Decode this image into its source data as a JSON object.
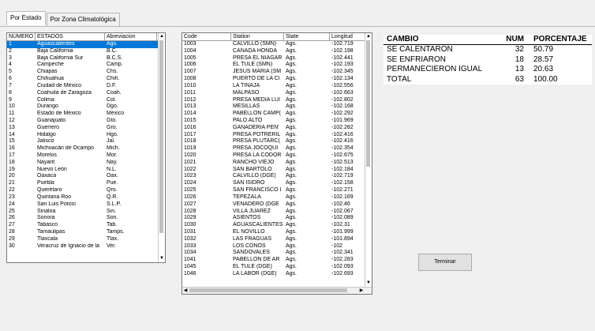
{
  "tabs": [
    {
      "label": "Por Estado",
      "active": true
    },
    {
      "label": "Por Zona Climatológica",
      "active": false
    }
  ],
  "states_table": {
    "headers": [
      "NÚMERO",
      "ESTADOS",
      "Abreviacion"
    ],
    "rows": [
      [
        "1",
        "Aguascalientes",
        "Ags."
      ],
      [
        "2",
        "Baja California",
        "B.C."
      ],
      [
        "3",
        "Baja California Sur",
        "B.C.S."
      ],
      [
        "4",
        "Campeche",
        "Camp."
      ],
      [
        "5",
        "Chiapas",
        "Chs."
      ],
      [
        "6",
        "Chihuahua",
        "Chih."
      ],
      [
        "7",
        "Ciudad de México",
        "D.F."
      ],
      [
        "8",
        "Coahuila de Zaragoza",
        "Coah."
      ],
      [
        "9",
        "Colima",
        "Col."
      ],
      [
        "10",
        "Durango",
        "Dgo."
      ],
      [
        "11",
        "Estado de México",
        "México"
      ],
      [
        "12",
        "Guanajuato",
        "Gto."
      ],
      [
        "13",
        "Guerrero",
        "Gro."
      ],
      [
        "14",
        "Hidalgo",
        "Hgo."
      ],
      [
        "15",
        "Jalisco",
        "Jal."
      ],
      [
        "16",
        "Michoacán de Ocampo",
        "Mich."
      ],
      [
        "17",
        "Morelos",
        "Mor."
      ],
      [
        "18",
        "Nayarit",
        "Nay."
      ],
      [
        "19",
        "Nuevo León",
        "N.L."
      ],
      [
        "20",
        "Oaxaca",
        "Oax."
      ],
      [
        "21",
        "Puebla",
        "Pue."
      ],
      [
        "22",
        "Querétaro",
        "Qro."
      ],
      [
        "23",
        "Quintana Roo",
        "Q.R."
      ],
      [
        "24",
        "San Luis Potosí",
        "S.L.P."
      ],
      [
        "25",
        "Sinaloa",
        "Sin."
      ],
      [
        "26",
        "Sonora",
        "Son."
      ],
      [
        "27",
        "Tabasco",
        "Tab."
      ],
      [
        "28",
        "Tamaulipas",
        "Tamps."
      ],
      [
        "29",
        "Tlaxcala",
        "Tlax."
      ],
      [
        "30",
        "Veracruz de Ignacio de la",
        "Ver."
      ]
    ],
    "selected_index": 0
  },
  "stations_table": {
    "headers": [
      "Code",
      "Station",
      "State",
      "Longitud"
    ],
    "rows": [
      [
        "1003",
        "CALVILLO (SMN)",
        "Ags.",
        "-102.719"
      ],
      [
        "1004",
        "CAÑADA HONDA",
        "Ags.",
        "-102.198"
      ],
      [
        "1005",
        "PRESA EL NIAGAR",
        "Ags.",
        "-102.441"
      ],
      [
        "1006",
        "EL TULE (SMN)",
        "Ags.",
        "-102.193"
      ],
      [
        "1007",
        "JESUS MARIA (SM",
        "Ags.",
        "-102.345"
      ],
      [
        "1008",
        "PUERTO DE LA CI",
        "Ags.",
        "-102.134"
      ],
      [
        "1010",
        "LA TINAJA",
        "Ags.",
        "-102.556"
      ],
      [
        "1011",
        "MALPASO",
        "Ags.",
        "-102.663"
      ],
      [
        "1012",
        "PRESA MEDIA LUI",
        "Ags.",
        "-102.802"
      ],
      [
        "1013",
        "MESILLAS",
        "Ags.",
        "-102.168"
      ],
      [
        "1014",
        "PABELLON CAMP(",
        "Ags.",
        "-102.292"
      ],
      [
        "1015",
        "PALO ALTO",
        "Ags.",
        "-101.969"
      ],
      [
        "1016",
        "GANADERIA PEÑ'",
        "Ags.",
        "-102.282"
      ],
      [
        "1017",
        "PRESA POTRERIL",
        "Ags.",
        "-102.416"
      ],
      [
        "1018",
        "PRESA PLUTARC(",
        "Ags.",
        "-102.416"
      ],
      [
        "1019",
        "PRESA JOCOQUI",
        "Ags.",
        "-102.354"
      ],
      [
        "1020",
        "PRESA LA CODOR",
        "Ags.",
        "-102.675"
      ],
      [
        "1021",
        "RANCHO VIEJO",
        "Ags.",
        "-102.513"
      ],
      [
        "1022",
        "SAN BARTOLO",
        "Ags.",
        "-102.184"
      ],
      [
        "1023",
        "CALVILLO (DGE)",
        "Ags.",
        "-102.719"
      ],
      [
        "1024",
        "SAN ISIDRO",
        "Ags.",
        "-102.158"
      ],
      [
        "1025",
        "SAN FRANCISCO I",
        "Ags.",
        "-102.271"
      ],
      [
        "1026",
        "TEPEZALA",
        "Ags.",
        "-102.169"
      ],
      [
        "1027",
        "VENADERO (DGE",
        "Ags.",
        "-102.46"
      ],
      [
        "1028",
        "VILLA JUAREZ",
        "Ags.",
        "-102.067"
      ],
      [
        "1029",
        "ASIENTOS",
        "Ags.",
        "-102.089"
      ],
      [
        "1030",
        "AGUASCALIENTES",
        "Ags.",
        "-102.31"
      ],
      [
        "1031",
        "EL NOVILLO",
        "Ags.",
        "-101.999"
      ],
      [
        "1032",
        "LAS FRAGUAS",
        "Ags.",
        "-101.894"
      ],
      [
        "1033",
        "LOS CONOS",
        "Ags.",
        "-102"
      ],
      [
        "1034",
        "SANDOVALES",
        "Ags.",
        "-102.341"
      ],
      [
        "1041",
        "PABELLON DE AR",
        "Ags.",
        "-102.283"
      ],
      [
        "1045",
        "EL TULE (DGE)",
        "Ags.",
        "-102.093"
      ],
      [
        "1046",
        "LA LABOR (DGE)",
        "Ags.",
        "-102.693"
      ]
    ]
  },
  "summary": {
    "headers": [
      "CAMBIO",
      "NUM",
      "PORCENTAJE"
    ],
    "rows": [
      [
        "SE CALENTARON",
        "32",
        "50.79"
      ],
      [
        "SE ENFRIARON",
        "18",
        "28.57"
      ],
      [
        "PERMANECIERON IGUAL",
        "13",
        "20.63"
      ],
      [
        "TOTAL",
        "63",
        "100.00"
      ]
    ]
  },
  "terminar_button": {
    "label": "Terminar"
  },
  "colors": {
    "selection": "#0078d7",
    "panel": "#f0f0f0"
  }
}
